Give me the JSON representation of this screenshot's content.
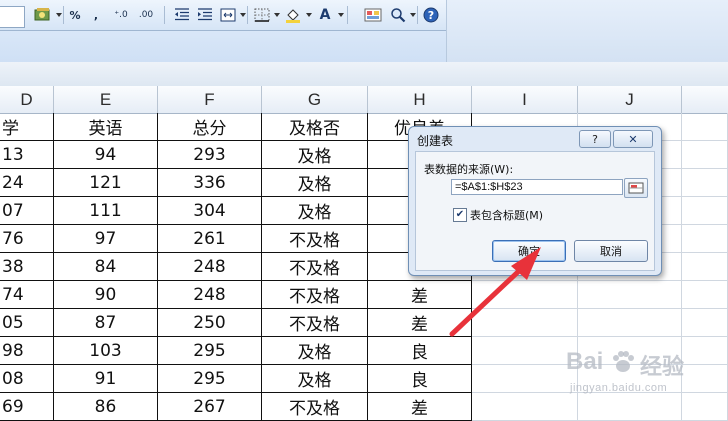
{
  "toolbar": {
    "percent": "%",
    "comma": ",",
    "increase_decimal": "⁺.0",
    "decrease_decimal": ".00",
    "font_color_letter": "A"
  },
  "columns": [
    "D",
    "E",
    "F",
    "G",
    "H",
    "I",
    "J"
  ],
  "table": {
    "headers": [
      "学",
      "英语",
      "总分",
      "及格否",
      "优良差"
    ],
    "rows": [
      [
        "13",
        "94",
        "293",
        "及格",
        ""
      ],
      [
        "24",
        "121",
        "336",
        "及格",
        ""
      ],
      [
        "07",
        "111",
        "304",
        "及格",
        ""
      ],
      [
        "76",
        "97",
        "261",
        "不及格",
        ""
      ],
      [
        "38",
        "84",
        "248",
        "不及格",
        ""
      ],
      [
        "74",
        "90",
        "248",
        "不及格",
        "差"
      ],
      [
        "05",
        "87",
        "250",
        "不及格",
        "差"
      ],
      [
        "98",
        "103",
        "295",
        "及格",
        "良"
      ],
      [
        "08",
        "91",
        "295",
        "及格",
        "良"
      ],
      [
        "69",
        "86",
        "267",
        "不及格",
        "差"
      ]
    ]
  },
  "dialog": {
    "title": "创建表",
    "help": "?",
    "close": "✕",
    "source_label": "表数据的来源(W):",
    "range_value": "=$A$1:$H$23",
    "has_headers_checked": true,
    "has_headers_label": "表包含标题(M)",
    "ok_label": "确定",
    "cancel_label": "取消"
  },
  "watermark": {
    "brand": "Bai",
    "brand_cn": "经验",
    "url": "jingyan.baidu.com"
  },
  "colors": {
    "arrow": "#e8323a",
    "grid": "#d0d7e0",
    "dialog_bg": "#dfe9f6"
  }
}
